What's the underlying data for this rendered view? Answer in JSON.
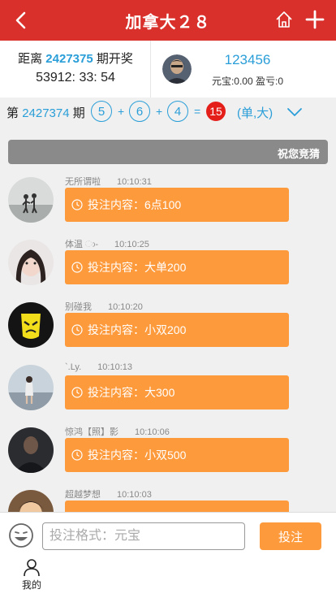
{
  "header": {
    "title": "加拿大２８"
  },
  "info": {
    "dist_prefix": "距离",
    "dist_issue": "2427375",
    "dist_suffix": "期开奖",
    "countdown": "53912: 33: 54",
    "user_name": "123456",
    "user_stat": "元宝:0.00 盈亏:0"
  },
  "result": {
    "prefix": "第",
    "issue": "2427374",
    "suffix": "期",
    "balls": [
      "5",
      "6",
      "4"
    ],
    "plus": "+",
    "equals": "=",
    "sum": "15",
    "kind": "(单,大)"
  },
  "marquee": {
    "text": "祝您竞猜"
  },
  "bets": [
    {
      "name": "无所谓啦",
      "time": "10:10:31",
      "content": "投注内容：6点100"
    },
    {
      "name": "体温 ා-",
      "time": "10:10:25",
      "content": "投注内容：大单200"
    },
    {
      "name": "别碰我",
      "time": "10:10:20",
      "content": "投注内容：小双200"
    },
    {
      "name": "`.Ly.",
      "time": "10:10:13",
      "content": "投注内容：大300"
    },
    {
      "name": "惊鸿【照】影",
      "time": "10:10:06",
      "content": "投注内容：小双500"
    },
    {
      "name": "超越梦想",
      "time": "10:10:03",
      "content": ""
    }
  ],
  "input": {
    "placeholder": "投注格式：元宝",
    "value": "",
    "send_label": "投注"
  },
  "tabbar": {
    "mine_label": "我的"
  },
  "colors": {
    "header": "#d9302c",
    "accent": "#2a9ed8",
    "bubble": "#fd9a3c",
    "sum_ball": "#e41f1a"
  }
}
